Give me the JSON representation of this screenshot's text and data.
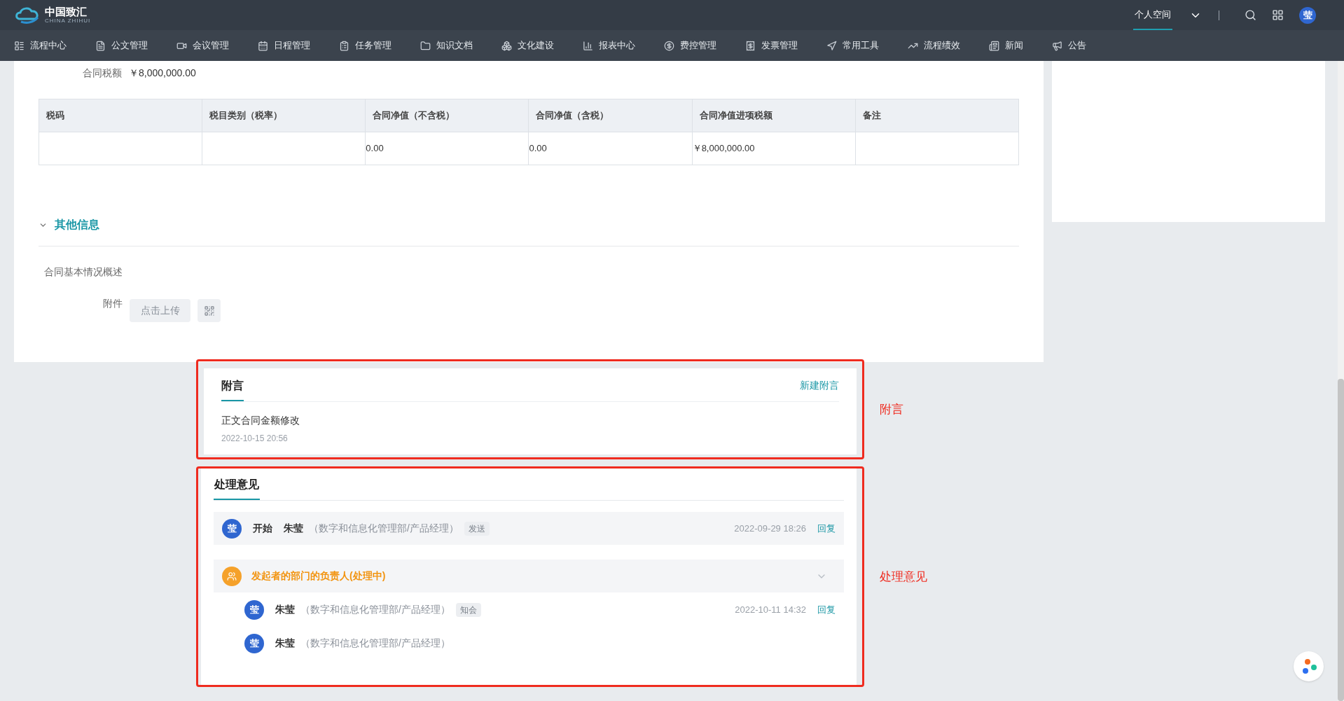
{
  "header": {
    "logo_text": "中国致汇",
    "logo_subtext": "CHINA ZHIHUI",
    "personal_space": {
      "label": "个人空间",
      "selected": true
    },
    "avatar": "莹"
  },
  "nav": [
    {
      "label": "流程中心"
    },
    {
      "label": "公文管理"
    },
    {
      "label": "会议管理"
    },
    {
      "label": "日程管理"
    },
    {
      "label": "任务管理"
    },
    {
      "label": "知识文档"
    },
    {
      "label": "文化建设"
    },
    {
      "label": "报表中心"
    },
    {
      "label": "费控管理"
    },
    {
      "label": "发票管理"
    },
    {
      "label": "常用工具"
    },
    {
      "label": "流程绩效"
    },
    {
      "label": "新闻"
    },
    {
      "label": "公告"
    }
  ],
  "contract_tax": {
    "label": "合同税额",
    "value": "￥8,000,000.00"
  },
  "tax_table": {
    "columns": [
      "税码",
      "税目类别（税率）",
      "合同净值（不含税）",
      "合同净值（含税）",
      "合同净值进项税额",
      "备注"
    ],
    "rows": [
      [
        "",
        "",
        "0.00",
        "0.00",
        "￥8,000,000.00",
        ""
      ]
    ]
  },
  "other_info": {
    "title": "其他信息",
    "expanded": true,
    "summary_label": "合同基本情况概述",
    "attachment_label": "附件",
    "upload_button": "点击上传"
  },
  "postscript": {
    "title": "附言",
    "selected": true,
    "new_button": "新建附言",
    "annotation": "附言",
    "items": [
      {
        "text": "正文合同金额修改",
        "time": "2022-10-15 20:56"
      }
    ]
  },
  "opinions": {
    "title": "处理意见",
    "selected": true,
    "annotation": "处理意见",
    "entries": [
      {
        "kind": "entry",
        "avatar": "莹",
        "step": "开始",
        "name": "朱莹",
        "dept": "（数字和信息化管理部/产品经理）",
        "tag": "发送",
        "time": "2022-09-29 18:26",
        "reply": "回复"
      },
      {
        "kind": "group",
        "title": "发起者的部门的负责人(处理中)",
        "expanded": true,
        "children": [
          {
            "kind": "entry",
            "avatar": "莹",
            "name": "朱莹",
            "dept": "（数字和信息化管理部/产品经理）",
            "tag": "知会",
            "time": "2022-10-11 14:32",
            "reply": "回复"
          },
          {
            "kind": "entry",
            "avatar": "莹",
            "name": "朱莹",
            "dept": "（数字和信息化管理部/产品经理）"
          }
        ]
      }
    ]
  }
}
